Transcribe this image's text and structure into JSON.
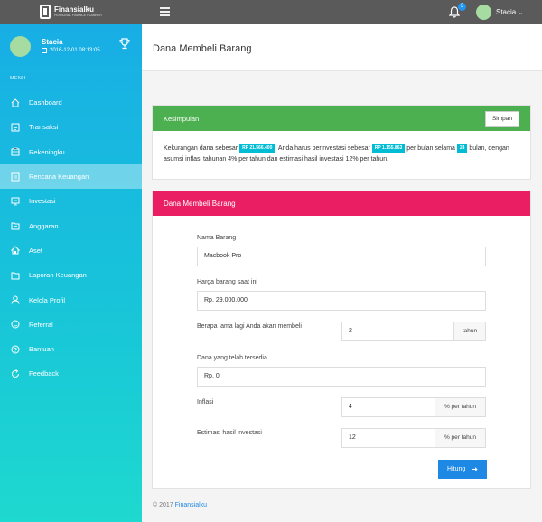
{
  "topbar": {
    "brand_name": "Finansialku",
    "brand_tag": "PERSONAL FINANCE PLANNER",
    "notification_count": "3",
    "user_name": "Stacia"
  },
  "sidebar": {
    "profile_name": "Stacia",
    "profile_date": "2016-12-01 08:13:05",
    "menu_label": "MENU",
    "items": [
      {
        "label": "Dashboard",
        "icon": "home-icon"
      },
      {
        "label": "Transaksi",
        "icon": "list-icon"
      },
      {
        "label": "Rekeningku",
        "icon": "wallet-icon"
      },
      {
        "label": "Rencana Keuangan",
        "icon": "plan-icon",
        "active": true
      },
      {
        "label": "Investasi",
        "icon": "monitor-icon"
      },
      {
        "label": "Anggaran",
        "icon": "folder-icon"
      },
      {
        "label": "Aset",
        "icon": "house-icon"
      },
      {
        "label": "Laporan Keuangan",
        "icon": "report-icon"
      },
      {
        "label": "Kelola Profil",
        "icon": "user-icon"
      },
      {
        "label": "Referral",
        "icon": "smile-icon"
      },
      {
        "label": "Bantuan",
        "icon": "help-icon"
      },
      {
        "label": "Feedback",
        "icon": "refresh-icon"
      }
    ]
  },
  "page": {
    "title": "Dana Membeli Barang"
  },
  "summary": {
    "header": "Kesimpulan",
    "save_label": "Simpan",
    "text_1": "Kekurangan dana sebesar",
    "chip_1": "RP 21.566.400",
    "text_2": ". Anda harus berinvestasi sebesar",
    "chip_2": "RP 1.155.863",
    "text_3": "per bulan selama",
    "chip_3": "24",
    "text_4": "bulan, dengan asumsi inflasi tahunan 4% per tahun dan estimasi hasil investasi 12% per tahun."
  },
  "form": {
    "header": "Dana Membeli Barang",
    "item_name_label": "Nama Barang",
    "item_name_value": "Macbook Pro",
    "price_label": "Harga barang saat ini",
    "price_value": "Rp. 29.000.000",
    "years_label": "Berapa lama lagi Anda akan membeli",
    "years_value": "2",
    "years_suffix": "tahun",
    "funds_label": "Dana yang telah tersedia",
    "funds_value": "Rp. 0",
    "inflation_label": "Inflasi",
    "inflation_value": "4",
    "inflation_suffix": "% per tahun",
    "return_label": "Estimasi hasil investasi",
    "return_value": "12",
    "return_suffix": "% per tahun",
    "calc_label": "Hitung"
  },
  "footer": {
    "copyright": "© 2017",
    "link": "Finansialku"
  },
  "colors": {
    "topbar": "#5a5a5a",
    "sidebar_top": "#18aee5",
    "sidebar_bottom": "#1ed9cf",
    "summary_header": "#4caf50",
    "form_header": "#e91e63",
    "chip": "#00bcd4",
    "button": "#1e88e5"
  }
}
